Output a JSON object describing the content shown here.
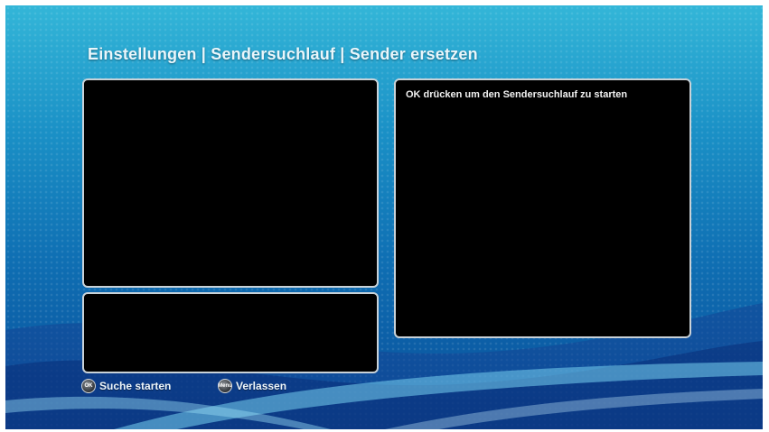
{
  "header": {
    "title": "Einstellungen | Sendersuchlauf | Sender ersetzen"
  },
  "info_panel": {
    "message": "OK drücken um den Sendersuchlauf zu starten"
  },
  "footer": {
    "ok_key_label": "OK",
    "ok_hint": "Suche starten",
    "exit_key_label": "Menu",
    "exit_hint": "Verlassen"
  },
  "colors": {
    "background_top": "#33b6d8",
    "background_bottom": "#0a4d96",
    "panel_fill": "#000000",
    "panel_border": "#c9d2d8",
    "text": "#eaf6fb"
  },
  "icons": {
    "ok_key": "ok-button-icon",
    "exit_key": "menu-button-icon"
  }
}
